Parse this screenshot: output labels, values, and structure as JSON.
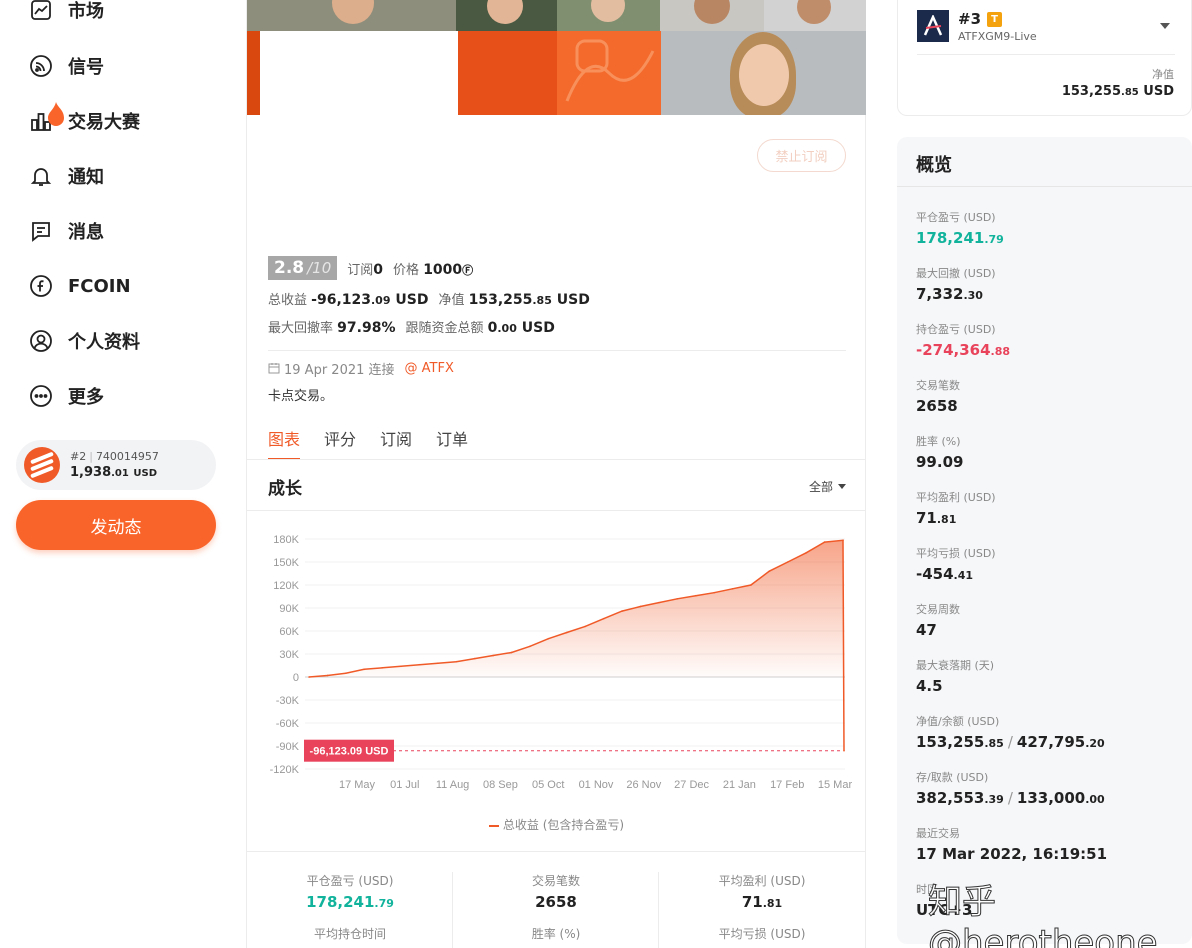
{
  "nav": {
    "items": [
      {
        "label": "市场",
        "icon": "chart-line-icon"
      },
      {
        "label": "信号",
        "icon": "signal-icon"
      },
      {
        "label": "交易大赛",
        "icon": "competition-icon"
      },
      {
        "label": "通知",
        "icon": "bell-icon"
      },
      {
        "label": "消息",
        "icon": "message-icon"
      },
      {
        "label": "FCOIN",
        "icon": "fcoin-icon"
      },
      {
        "label": "个人资料",
        "icon": "user-icon"
      },
      {
        "label": "更多",
        "icon": "more-icon"
      }
    ],
    "account": {
      "rank": "#2",
      "id": "740014957",
      "balance_main": "1,938",
      "balance_dec": ".01",
      "currency": "USD"
    },
    "post_button": "发动态"
  },
  "signal": {
    "subscribe_button": "禁止订阅",
    "score": "2.8",
    "score_denom": "/10",
    "subscribers_label": "订阅",
    "subscribers": "0",
    "price_label": "价格",
    "price": "1000",
    "price_unit": "Ⓕ",
    "total_profit_label": "总收益",
    "total_profit_main": "-96,123",
    "total_profit_dec": ".09",
    "total_profit_cur": "USD",
    "equity_label": "净值",
    "equity_main": "153,255",
    "equity_dec": ".85",
    "equity_cur": "USD",
    "max_dd_label": "最大回撤率",
    "max_dd": "97.98%",
    "follow_funds_label": "跟随资金总额",
    "follow_funds_main": "0",
    "follow_funds_dec": ".00",
    "follow_funds_cur": "USD",
    "connected": "19 Apr 2021 连接",
    "broker": "@ ATFX",
    "description": "卡点交易。"
  },
  "tabs": [
    "图表",
    "评分",
    "订阅",
    "订单"
  ],
  "chart_header": {
    "title": "成长",
    "range": "全部"
  },
  "chart_data": {
    "type": "area",
    "title": "成长",
    "yticks": [
      "180K",
      "150K",
      "120K",
      "90K",
      "60K",
      "30K",
      "0",
      "-30K",
      "-60K",
      "-90K",
      "-120K"
    ],
    "ylim": [
      -120000,
      180000
    ],
    "xticks": [
      "17 May",
      "01 Jul",
      "11 Aug",
      "08 Sep",
      "05 Oct",
      "01 Nov",
      "26 Nov",
      "27 Dec",
      "21 Jan",
      "17 Feb",
      "15 Mar"
    ],
    "series": [
      {
        "name": "总收益 (包含持合盈亏)",
        "color": "#f05a28",
        "values": [
          0,
          2000,
          5000,
          10000,
          12000,
          14000,
          16000,
          18000,
          20000,
          24000,
          28000,
          32000,
          40000,
          50000,
          58000,
          66000,
          76000,
          86000,
          92000,
          97000,
          102000,
          106000,
          110000,
          115000,
          120000,
          138000,
          150000,
          162000,
          176000,
          178241,
          -96123.09
        ]
      }
    ],
    "last_value_label": "-96,123.09 USD",
    "legend": "总收益 (包含持合盈亏)"
  },
  "bottom_stats": [
    {
      "label": "平仓盈亏 (USD)",
      "value_main": "178,241",
      "value_dec": ".79",
      "positive": true,
      "label2": "平均持仓时间"
    },
    {
      "label": "交易笔数",
      "value_main": "2658",
      "value_dec": "",
      "positive": false,
      "label2": "胜率 (%)"
    },
    {
      "label": "平均盈利 (USD)",
      "value_main": "71",
      "value_dec": ".81",
      "positive": false,
      "label2": "平均亏损 (USD)"
    }
  ],
  "account_box": {
    "rank": "#3",
    "badge": "T",
    "name": "ATFXGM9-Live",
    "equity_label": "净值",
    "equity_main": "153,255",
    "equity_dec": ".85",
    "equity_cur": "USD"
  },
  "overview": {
    "title": "概览",
    "items": [
      {
        "label": "平仓盈亏 (USD)",
        "main": "178,241",
        "dec": ".79",
        "tone": "pos"
      },
      {
        "label": "最大回撤 (USD)",
        "main": "7,332",
        "dec": ".30",
        "tone": ""
      },
      {
        "label": "持仓盈亏 (USD)",
        "main": "-274,364",
        "dec": ".88",
        "tone": "neg"
      },
      {
        "label": "交易笔数",
        "main": "2658",
        "dec": "",
        "tone": ""
      },
      {
        "label": "胜率 (%)",
        "main": "99.09",
        "dec": "",
        "tone": ""
      },
      {
        "label": "平均盈利 (USD)",
        "main": "71",
        "dec": ".81",
        "tone": ""
      },
      {
        "label": "平均亏损 (USD)",
        "main": "-454",
        "dec": ".41",
        "tone": ""
      },
      {
        "label": "交易周数",
        "main": "47",
        "dec": "",
        "tone": ""
      },
      {
        "label": "最大衰落期 (天)",
        "main": "4.5",
        "dec": "",
        "tone": ""
      },
      {
        "label": "净值/余额 (USD)",
        "main": "153,255",
        "dec": ".85",
        "main2": "427,795",
        "dec2": ".20",
        "tone": ""
      },
      {
        "label": "存/取款 (USD)",
        "main": "382,553",
        "dec": ".39",
        "main2": "133,000",
        "dec2": ".00",
        "tone": ""
      },
      {
        "label": "最近交易",
        "main": "17 Mar 2022, 16:19:51",
        "dec": "",
        "tone": ""
      },
      {
        "label": "时区",
        "main": "UTC+3",
        "dec": "",
        "tone": ""
      }
    ]
  },
  "watermark": "知乎 @herotheone"
}
